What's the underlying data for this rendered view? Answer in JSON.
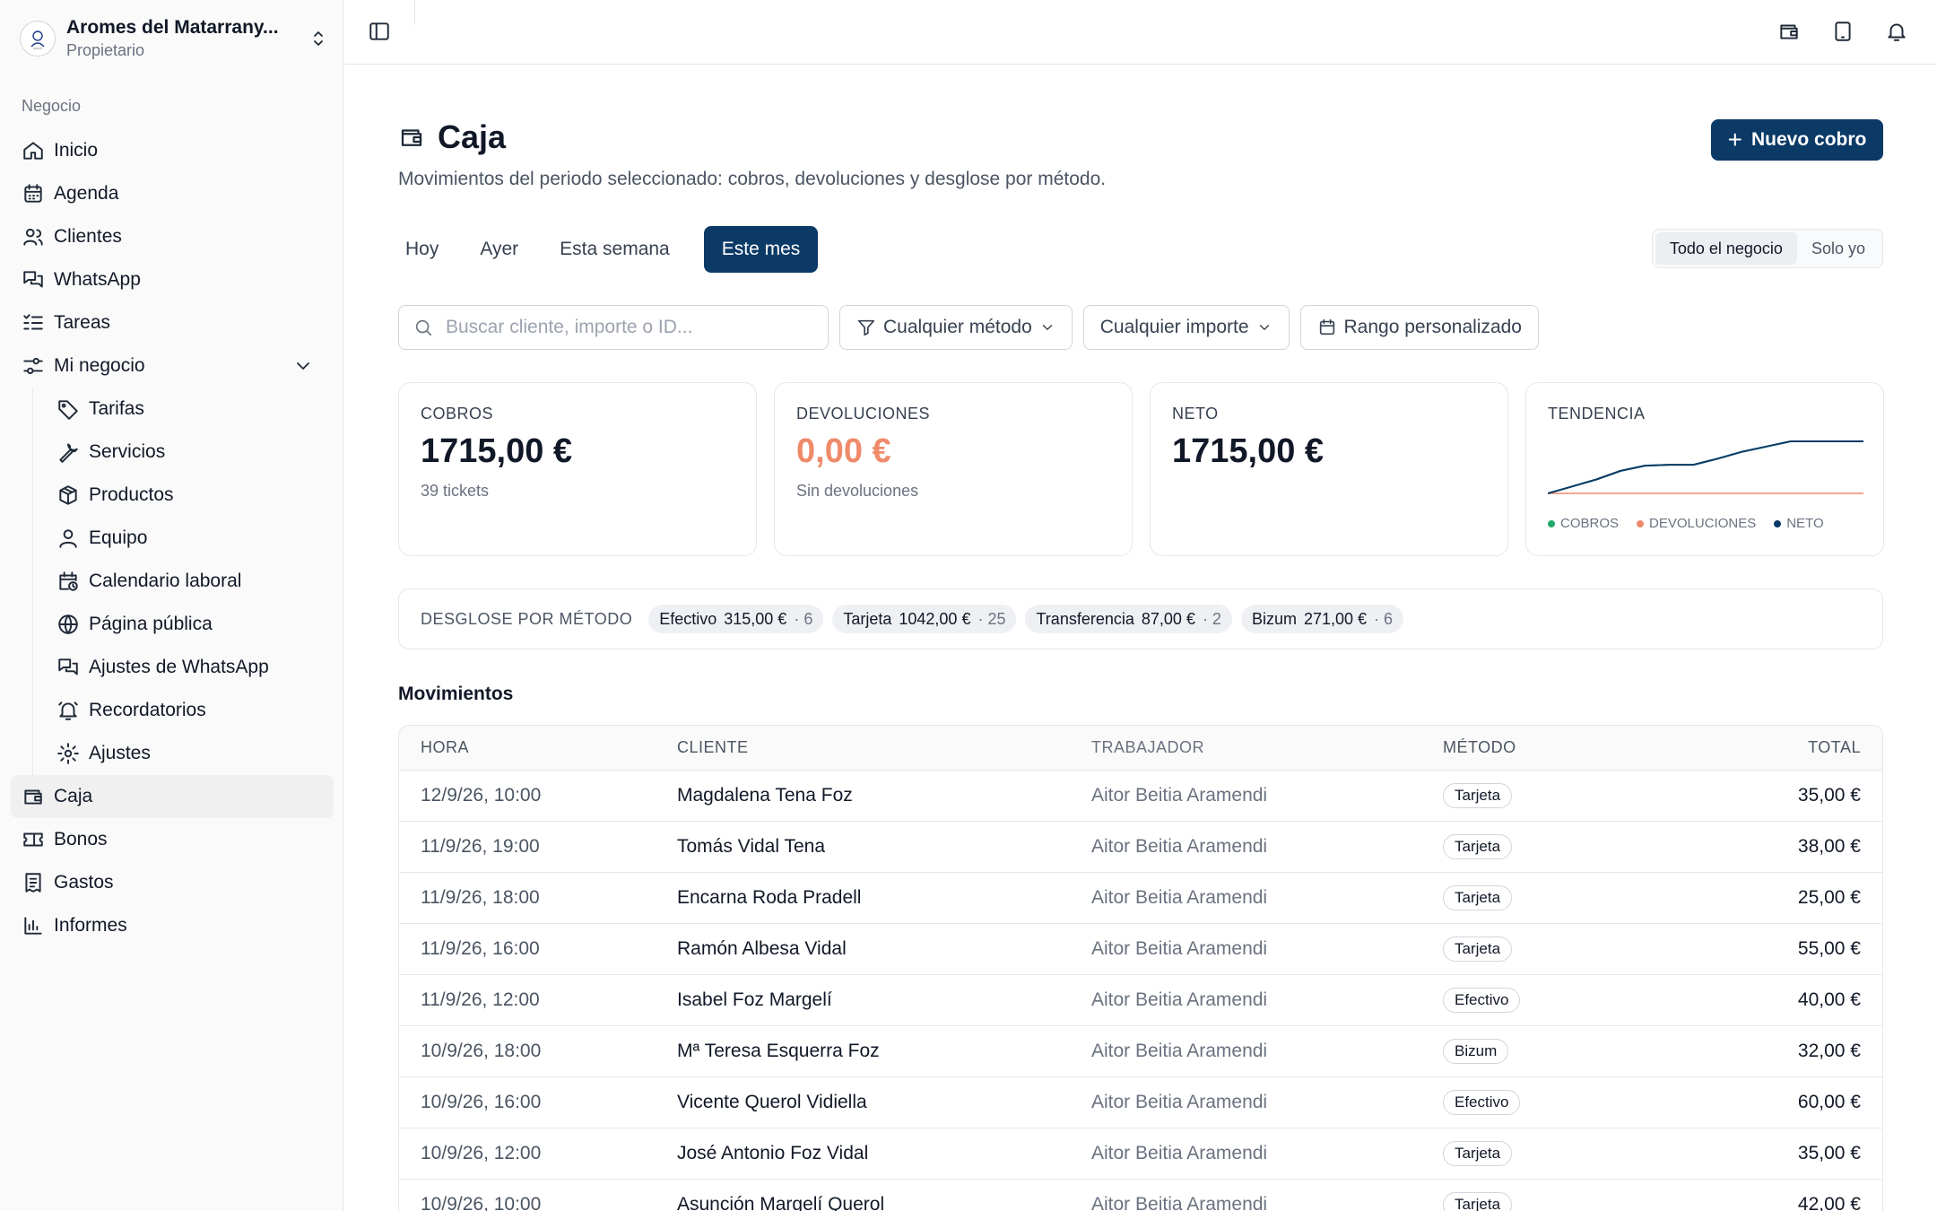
{
  "business": {
    "name": "Aromes del Matarrany...",
    "role": "Propietario"
  },
  "nav": {
    "heading": "Negocio",
    "items": [
      {
        "label": "Inicio",
        "icon": "home-icon"
      },
      {
        "label": "Agenda",
        "icon": "calendar-icon"
      },
      {
        "label": "Clientes",
        "icon": "users-icon"
      },
      {
        "label": "WhatsApp",
        "icon": "chat-icon"
      },
      {
        "label": "Tareas",
        "icon": "tasks-icon"
      },
      {
        "label": "Mi negocio",
        "icon": "sliders-icon"
      }
    ],
    "sub_items": [
      {
        "label": "Tarifas",
        "icon": "tag-icon"
      },
      {
        "label": "Servicios",
        "icon": "wrench-icon"
      },
      {
        "label": "Productos",
        "icon": "box-icon"
      },
      {
        "label": "Equipo",
        "icon": "user-icon"
      },
      {
        "label": "Calendario laboral",
        "icon": "calendar-clock-icon"
      },
      {
        "label": "Página pública",
        "icon": "globe-icon"
      },
      {
        "label": "Ajustes de WhatsApp",
        "icon": "chat-icon"
      },
      {
        "label": "Recordatorios",
        "icon": "bell-icon"
      },
      {
        "label": "Ajustes",
        "icon": "gear-icon"
      }
    ],
    "bottom_items": [
      {
        "label": "Caja",
        "icon": "wallet-icon",
        "active": true
      },
      {
        "label": "Bonos",
        "icon": "ticket-icon"
      },
      {
        "label": "Gastos",
        "icon": "receipt-icon"
      },
      {
        "label": "Informes",
        "icon": "bar-chart-icon"
      }
    ]
  },
  "page": {
    "title": "Caja",
    "subtitle": "Movimientos del periodo seleccionado: cobros, devoluciones y desglose por método.",
    "new_button": "Nuevo cobro"
  },
  "tabs": [
    "Hoy",
    "Ayer",
    "Esta semana",
    "Este mes"
  ],
  "active_tab": "Este mes",
  "scope": {
    "all": "Todo el negocio",
    "mine": "Solo yo"
  },
  "filters": {
    "search_placeholder": "Buscar cliente, importe o ID...",
    "method": "Cualquier método",
    "amount": "Cualquier importe",
    "range": "Rango personalizado"
  },
  "cards": {
    "cobros": {
      "label": "COBROS",
      "value": "1715,00 €",
      "sub": "39 tickets"
    },
    "devoluciones": {
      "label": "DEVOLUCIONES",
      "value": "0,00 €",
      "sub": "Sin devoluciones"
    },
    "neto": {
      "label": "NETO",
      "value": "1715,00 €"
    },
    "tendencia": {
      "label": "TENDENCIA",
      "legend": [
        "COBROS",
        "DEVOLUCIONES",
        "NETO"
      ]
    }
  },
  "chart_data": {
    "type": "line",
    "series": [
      {
        "name": "COBROS",
        "color": "#22a86b",
        "values": [
          0,
          40,
          80,
          130,
          160,
          165,
          165,
          200,
          240,
          270,
          300,
          300,
          300,
          300
        ]
      },
      {
        "name": "DEVOLUCIONES",
        "color": "#ef8b6b",
        "values": [
          0,
          0,
          0,
          0,
          0,
          0,
          0,
          0,
          0,
          0,
          0,
          0,
          0,
          0
        ]
      },
      {
        "name": "NETO",
        "color": "#0b3a67",
        "values": [
          0,
          40,
          80,
          130,
          160,
          165,
          165,
          200,
          240,
          270,
          300,
          300,
          300,
          300
        ]
      }
    ],
    "grid": false,
    "legend": "bottom"
  },
  "breakdown": {
    "label": "DESGLOSE POR MÉTODO",
    "chips": [
      {
        "method": "Efectivo",
        "amount": "315,00 €",
        "count": "· 6"
      },
      {
        "method": "Tarjeta",
        "amount": "1042,00 €",
        "count": "· 25"
      },
      {
        "method": "Transferencia",
        "amount": "87,00 €",
        "count": "· 2"
      },
      {
        "method": "Bizum",
        "amount": "271,00 €",
        "count": "· 6"
      }
    ]
  },
  "movimientos": {
    "title": "Movimientos",
    "columns": [
      "HORA",
      "CLIENTE",
      "TRABAJADOR",
      "MÉTODO",
      "TOTAL"
    ],
    "rows": [
      {
        "hora": "12/9/26, 10:00",
        "cliente": "Magdalena Tena Foz",
        "trabajador": "Aitor Beitia Aramendi",
        "metodo": "Tarjeta",
        "total": "35,00 €"
      },
      {
        "hora": "11/9/26, 19:00",
        "cliente": "Tomás Vidal Tena",
        "trabajador": "Aitor Beitia Aramendi",
        "metodo": "Tarjeta",
        "total": "38,00 €"
      },
      {
        "hora": "11/9/26, 18:00",
        "cliente": "Encarna Roda Pradell",
        "trabajador": "Aitor Beitia Aramendi",
        "metodo": "Tarjeta",
        "total": "25,00 €"
      },
      {
        "hora": "11/9/26, 16:00",
        "cliente": "Ramón Albesa Vidal",
        "trabajador": "Aitor Beitia Aramendi",
        "metodo": "Tarjeta",
        "total": "55,00 €"
      },
      {
        "hora": "11/9/26, 12:00",
        "cliente": "Isabel Foz Margelí",
        "trabajador": "Aitor Beitia Aramendi",
        "metodo": "Efectivo",
        "total": "40,00 €"
      },
      {
        "hora": "10/9/26, 18:00",
        "cliente": "Mª Teresa Esquerra Foz",
        "trabajador": "Aitor Beitia Aramendi",
        "metodo": "Bizum",
        "total": "32,00 €"
      },
      {
        "hora": "10/9/26, 16:00",
        "cliente": "Vicente Querol Vidiella",
        "trabajador": "Aitor Beitia Aramendi",
        "metodo": "Efectivo",
        "total": "60,00 €"
      },
      {
        "hora": "10/9/26, 12:00",
        "cliente": "José Antonio Foz Vidal",
        "trabajador": "Aitor Beitia Aramendi",
        "metodo": "Tarjeta",
        "total": "35,00 €"
      },
      {
        "hora": "10/9/26, 10:00",
        "cliente": "Asunción Margelí Querol",
        "trabajador": "Aitor Beitia Aramendi",
        "metodo": "Tarjeta",
        "total": "42,00 €"
      }
    ]
  }
}
